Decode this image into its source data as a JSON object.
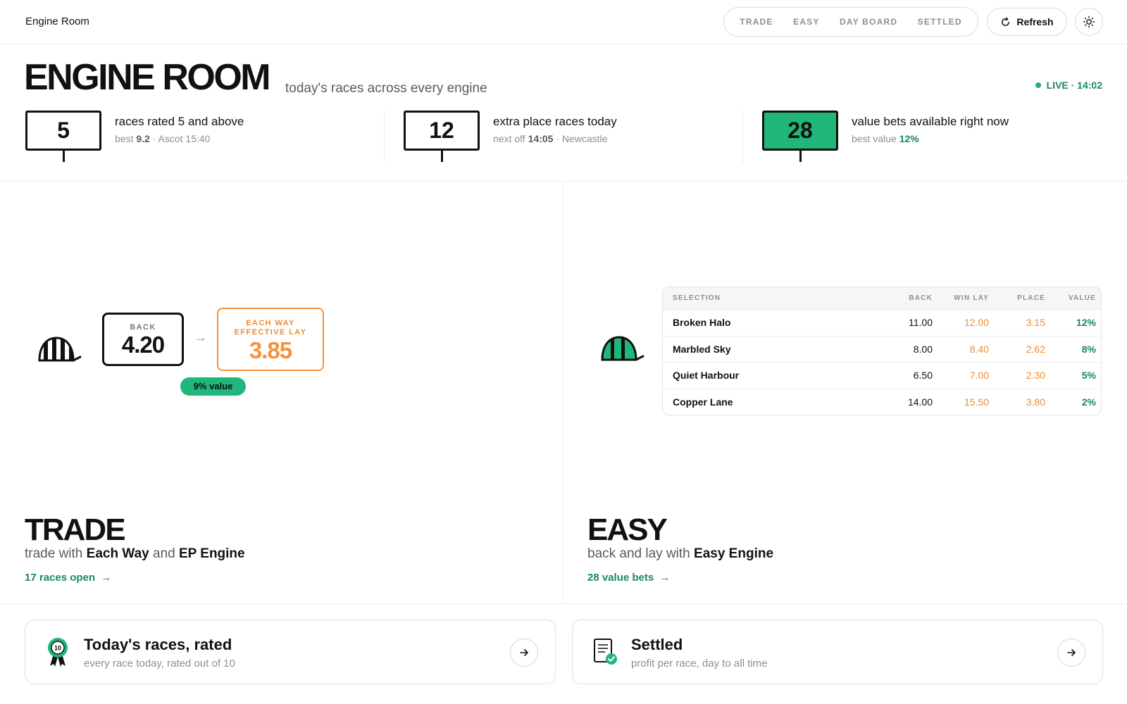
{
  "app": {
    "title": "Engine Room"
  },
  "nav": {
    "items": [
      "TRADE",
      "EASY",
      "DAY BOARD",
      "SETTLED"
    ],
    "refresh_label": "Refresh"
  },
  "hero": {
    "title": "ENGINE ROOM",
    "subtitle": "today's races across every engine",
    "live": "LIVE · 14:02"
  },
  "stats": [
    {
      "value": "5",
      "label": "races rated 5 and above",
      "detail_prefix": "best",
      "detail_bold": "9.2",
      "detail_suffix": "· Ascot 15:40"
    },
    {
      "value": "12",
      "label": "extra place races today",
      "detail_prefix": "next off",
      "detail_bold": "14:05",
      "detail_suffix": "· Newcastle"
    },
    {
      "value": "28",
      "label": "value bets available right now",
      "detail_prefix": "best value",
      "detail_bold": "12%",
      "detail_suffix": ""
    }
  ],
  "trade": {
    "back_label": "BACK",
    "back_value": "4.20",
    "ew_label_1": "EACH WAY",
    "ew_label_2": "EFFECTIVE LAY",
    "ew_value": "3.85",
    "value_badge": "9% value",
    "title": "TRADE",
    "sub_prefix": "trade with",
    "sub_b1": "Each Way",
    "sub_mid": "and",
    "sub_b2": "EP Engine",
    "link": "17 races open"
  },
  "easy": {
    "headers": {
      "selection": "SELECTION",
      "back": "BACK",
      "win_lay": "WIN LAY",
      "place": "PLACE",
      "value": "VALUE"
    },
    "rows": [
      {
        "selection": "Broken Halo",
        "back": "11.00",
        "win_lay": "12.00",
        "place": "3.15",
        "value": "12%"
      },
      {
        "selection": "Marbled Sky",
        "back": "8.00",
        "win_lay": "8.40",
        "place": "2.62",
        "value": "8%"
      },
      {
        "selection": "Quiet Harbour",
        "back": "6.50",
        "win_lay": "7.00",
        "place": "2.30",
        "value": "5%"
      },
      {
        "selection": "Copper Lane",
        "back": "14.00",
        "win_lay": "15.50",
        "place": "3.80",
        "value": "2%"
      }
    ],
    "title": "EASY",
    "sub_prefix": "back and lay with",
    "sub_b1": "Easy Engine",
    "link": "28 value bets"
  },
  "cards": [
    {
      "title": "Today's races, rated",
      "subtitle": "every race today, rated out of 10",
      "icon": "rosette-icon",
      "rosette_text": "10"
    },
    {
      "title": "Settled",
      "subtitle": "profit per race, day to all time",
      "icon": "settled-document-icon"
    }
  ],
  "colors": {
    "accent_green": "#1fb77a",
    "text_green": "#1a8a57",
    "orange": "#f5923e"
  }
}
